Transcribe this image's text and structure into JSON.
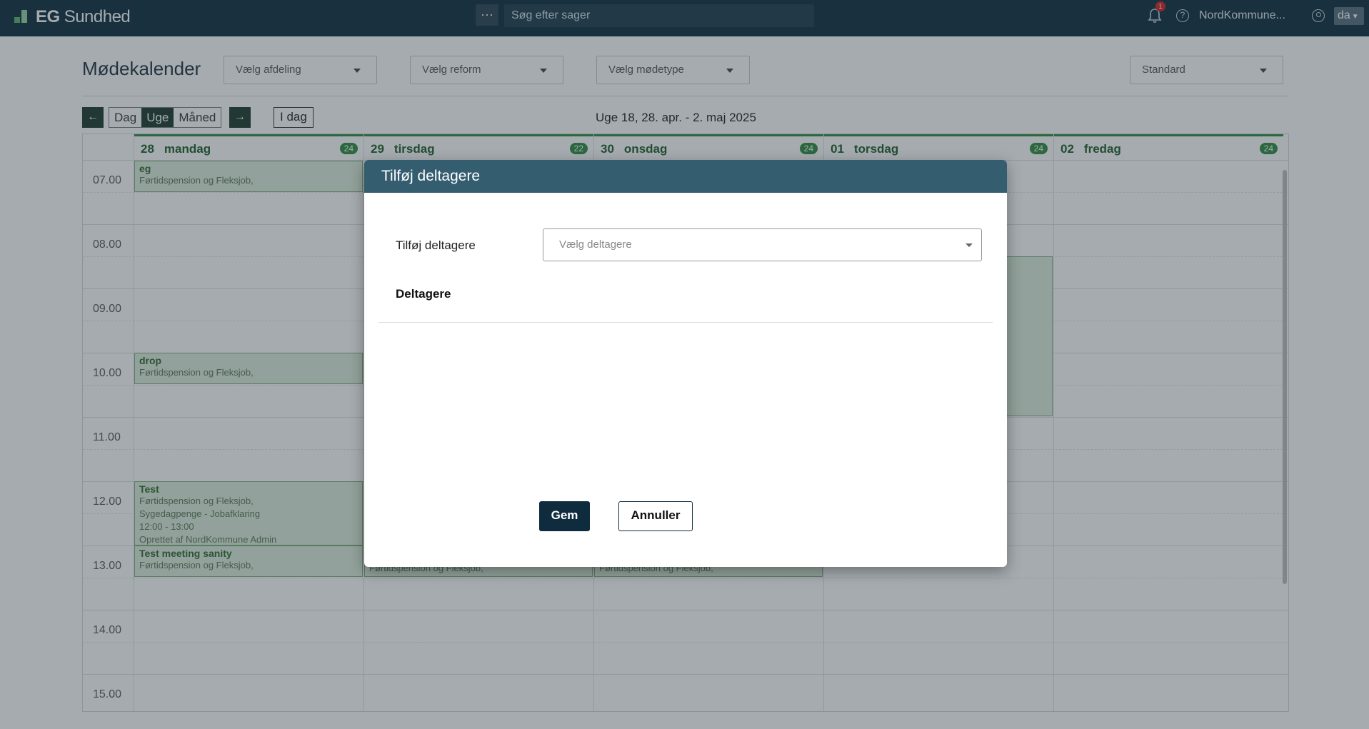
{
  "app": {
    "brand_bold": "EG",
    "brand_light": "Sundhed",
    "more_label": "···",
    "search_placeholder": "Søg efter sager",
    "notification_count": "1",
    "organization": "NordKommune...",
    "language": "da"
  },
  "page": {
    "title": "Mødekalender",
    "filters": {
      "department": "Vælg afdeling",
      "reform": "Vælg reform",
      "meeting_type": "Vælg mødetype",
      "view": "Standard"
    }
  },
  "toolbar": {
    "prev": "←",
    "next": "→",
    "views": [
      "Dag",
      "Uge",
      "Måned"
    ],
    "active_view": "Uge",
    "today": "I dag",
    "week_label": "Uge 18,   28. apr. - 2. maj 2025"
  },
  "calendar": {
    "days": [
      {
        "num": "28",
        "name": "mandag",
        "count": "24"
      },
      {
        "num": "29",
        "name": "tirsdag",
        "count": "22"
      },
      {
        "num": "30",
        "name": "onsdag",
        "count": "24"
      },
      {
        "num": "01",
        "name": "torsdag",
        "count": "24"
      },
      {
        "num": "02",
        "name": "fredag",
        "count": "24"
      }
    ],
    "hours": [
      "07.00",
      "08.00",
      "09.00",
      "10.00",
      "11.00",
      "12.00",
      "13.00",
      "14.00",
      "15.00"
    ],
    "events": {
      "eg": {
        "title": "eg",
        "lines": [
          "Førtidspension og Fleksjob,"
        ]
      },
      "drop": {
        "title": "drop",
        "lines": [
          "Førtidspension og Fleksjob,"
        ]
      },
      "test": {
        "title": "Test",
        "lines": [
          "Førtidspension og Fleksjob,",
          "Sygedagpenge - Jobafklaring",
          "12:00 - 13:00",
          "Oprettet af NordKommune Admin"
        ]
      },
      "sanity": {
        "title": "Test meeting sanity",
        "lines": [
          "Førtidspension og Fleksjob,"
        ]
      },
      "tue13": {
        "lines": [
          "Førtidspension og Fleksjob,"
        ]
      },
      "wed13": {
        "lines": [
          "Førtidspension og Fleksjob,"
        ]
      }
    }
  },
  "modal": {
    "title": "Tilføj deltagere",
    "field_label": "Tilføj deltagere",
    "select_placeholder": "Vælg deltagere",
    "section_title": "Deltagere",
    "save": "Gem",
    "cancel": "Annuller"
  }
}
